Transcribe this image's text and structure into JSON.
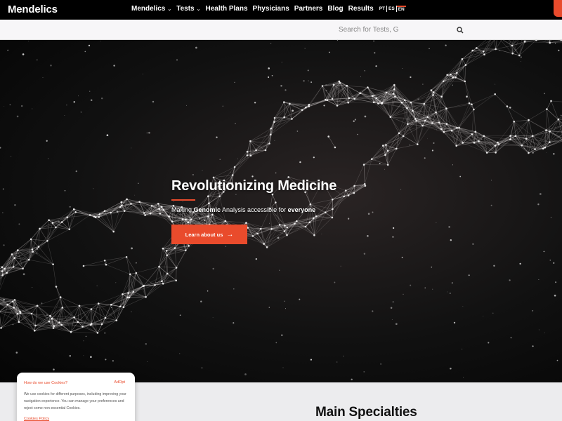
{
  "header": {
    "logo": "Mendelics",
    "nav": [
      {
        "label": "Mendelics",
        "dropdown": true
      },
      {
        "label": "Tests",
        "dropdown": true
      },
      {
        "label": "Health Plans",
        "dropdown": false
      },
      {
        "label": "Physicians",
        "dropdown": false
      },
      {
        "label": "Partners",
        "dropdown": false
      },
      {
        "label": "Blog",
        "dropdown": false
      },
      {
        "label": "Results",
        "dropdown": false
      }
    ],
    "languages": [
      "PT",
      "ES",
      "EN"
    ],
    "active_language": "EN"
  },
  "search": {
    "placeholder": "Search for Tests, G"
  },
  "hero": {
    "title": "Revolutionizing Medicine",
    "subtitle_prefix": "Making ",
    "subtitle_bold1": "Genomic",
    "subtitle_middle": " Analysis accessible for ",
    "subtitle_bold2": "everyone",
    "cta_label": "Learn about us"
  },
  "specialties": {
    "title": "Main Specialties"
  },
  "cookies": {
    "title": "How do we use Cookies?",
    "link": "AdOpt",
    "text": "We use cookies for different purposes, including improving your navigation experience. You can manage your preferences and reject some non-essential Cookies.",
    "policy": "Cookies Policy"
  },
  "colors": {
    "accent": "#e94b2c",
    "header_bg": "#000000",
    "searchbar_bg": "#f7f6f8"
  }
}
